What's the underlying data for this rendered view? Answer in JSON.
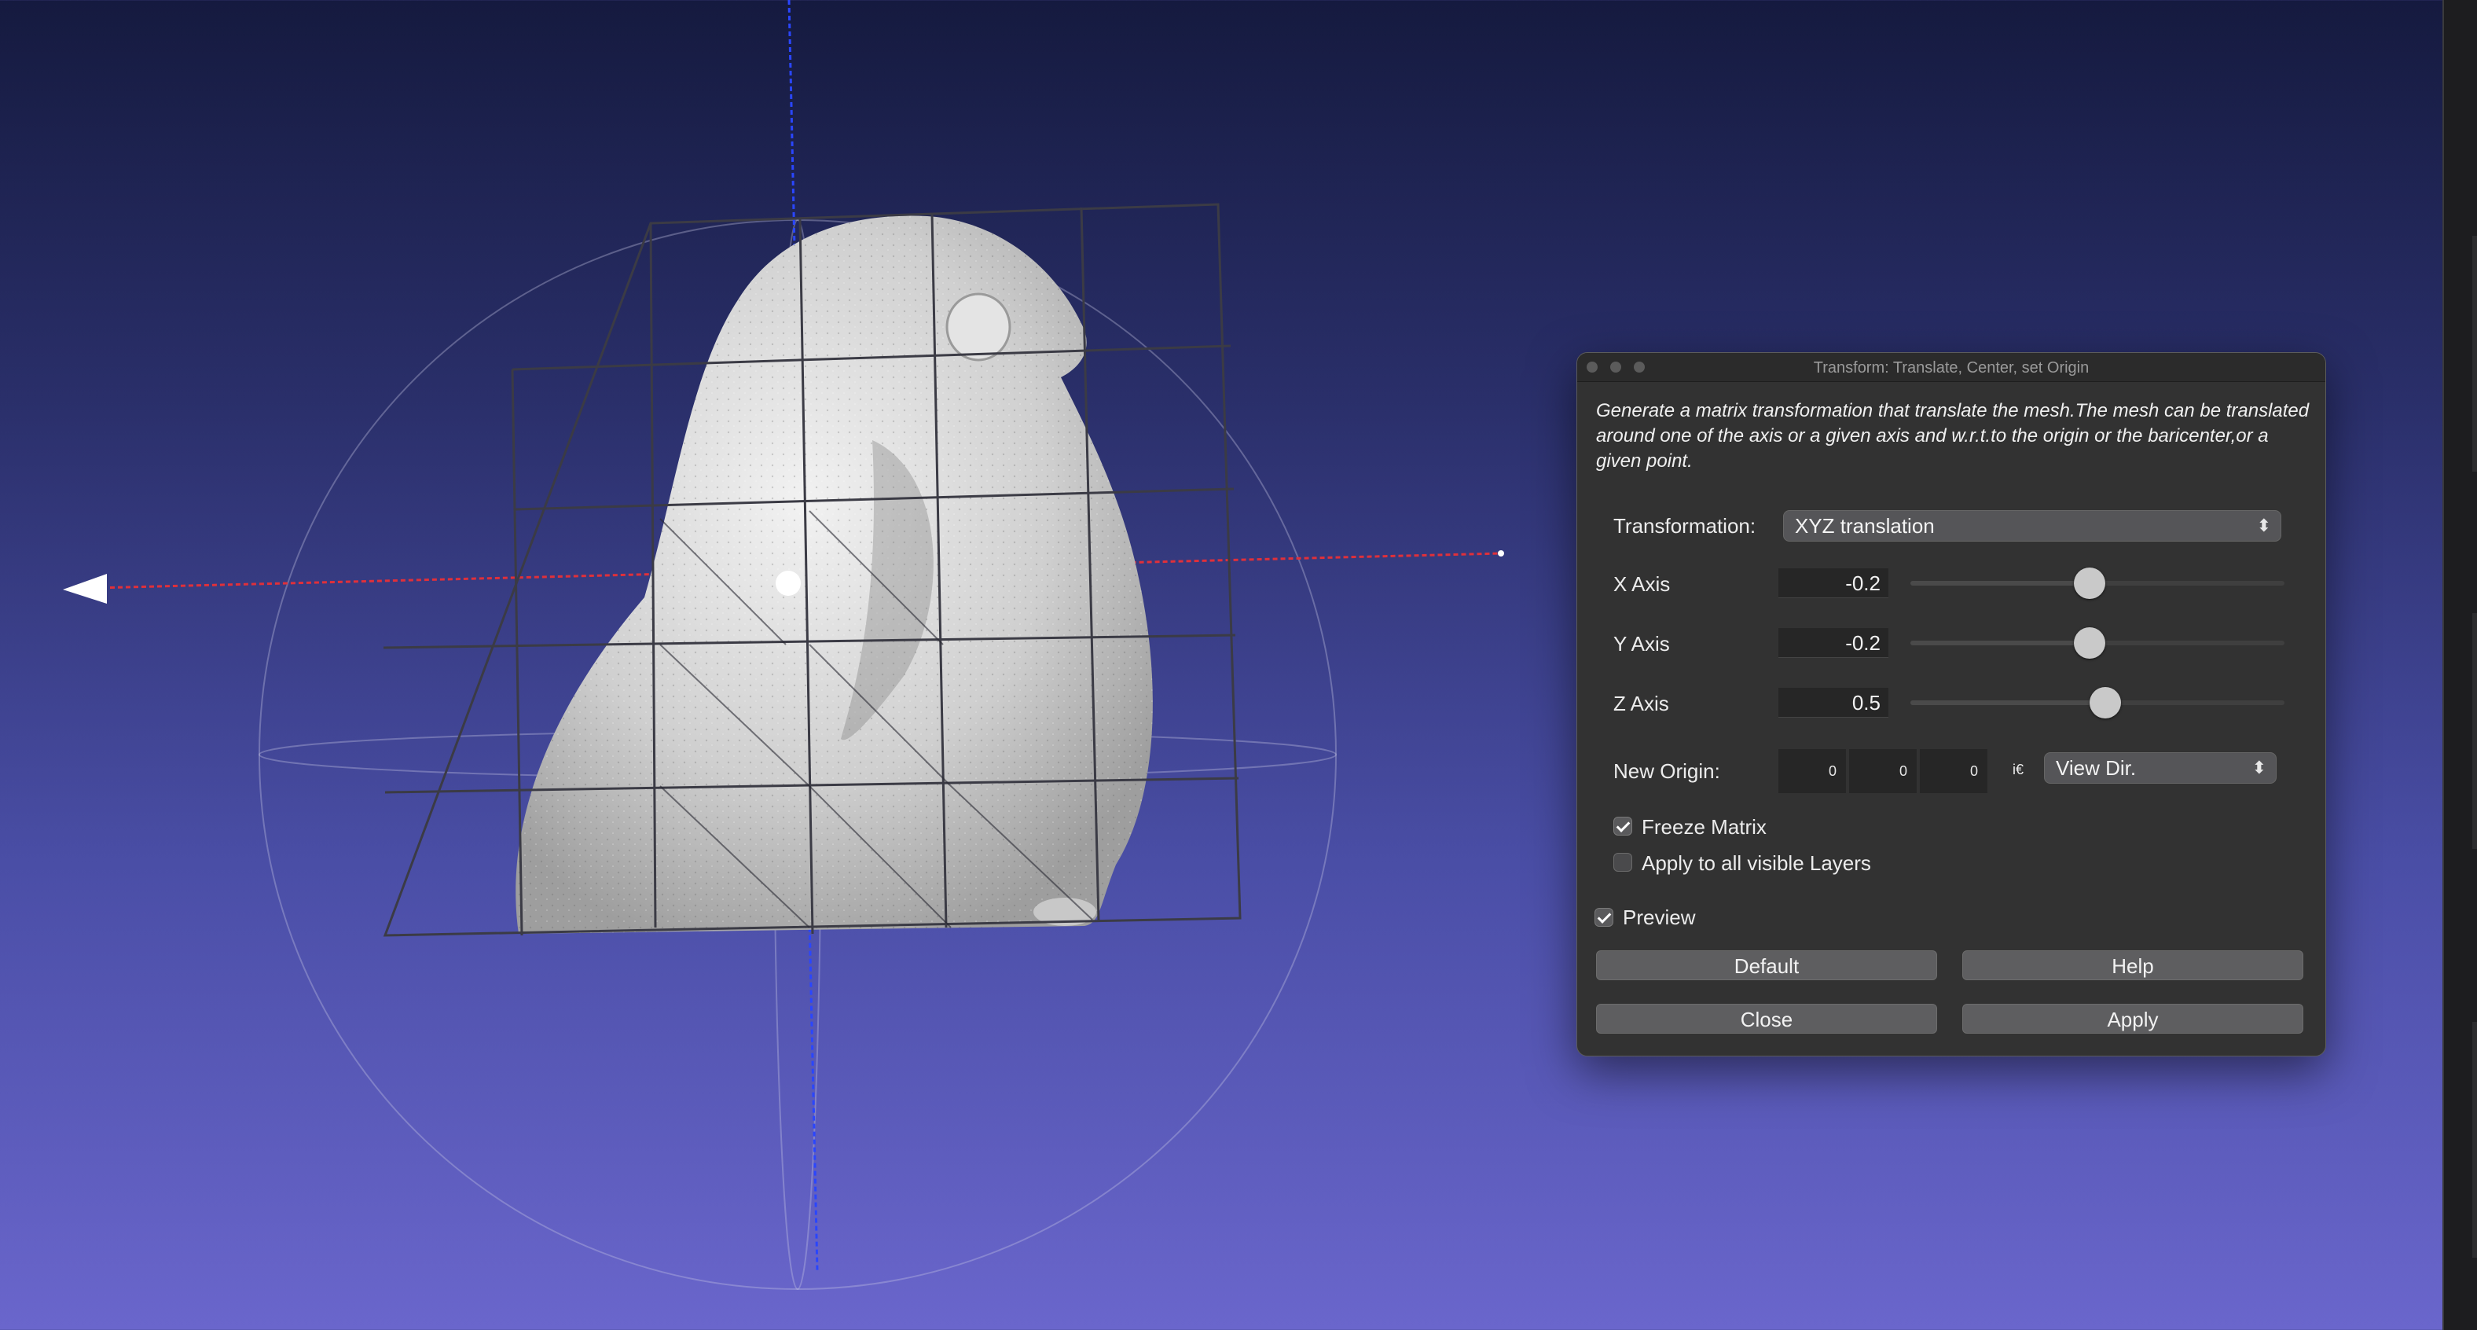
{
  "dialog": {
    "title": "Transform: Translate, Center, set Origin",
    "description": "Generate a matrix transformation that translate the mesh.The mesh can be translated around one of the axis or a given axis and w.r.t.to the origin or the baricenter,or a given point.",
    "transformation_label": "Transformation:",
    "transformation_value": "XYZ translation",
    "x_axis": {
      "label": "X Axis",
      "value": "-0.2",
      "slider_fraction": 0.48
    },
    "y_axis": {
      "label": "Y Axis",
      "value": "-0.2",
      "slider_fraction": 0.48
    },
    "z_axis": {
      "label": "Z Axis",
      "value": "0.5",
      "slider_fraction": 0.52
    },
    "new_origin": {
      "label": "New Origin:",
      "values": [
        "0",
        "0",
        "0"
      ],
      "unit_glyph": "i€",
      "mode": "View Dir."
    },
    "freeze_matrix": {
      "label": "Freeze Matrix",
      "checked": true
    },
    "apply_all_layers": {
      "label": "Apply to all visible Layers",
      "checked": false
    },
    "preview": {
      "label": "Preview",
      "checked": true
    },
    "buttons": {
      "default": "Default",
      "help": "Help",
      "close": "Close",
      "apply": "Apply"
    }
  },
  "colors": {
    "x_axis_line": "#e0303a",
    "z_axis_line": "#2040ff",
    "mesh": "#d8d8d8",
    "background_top": "#151a3f",
    "background_bottom": "#6a66cc"
  }
}
